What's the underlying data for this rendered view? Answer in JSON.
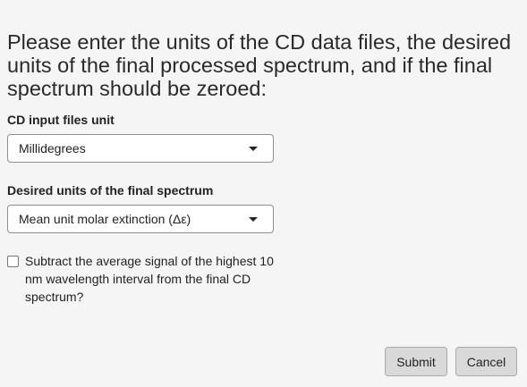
{
  "prompt": {
    "heading": "Please enter the units of the CD data files, the desired units of the final processed spectrum, and if the final spectrum should be zeroed:"
  },
  "input_unit": {
    "label": "CD input files unit",
    "selected": "Millidegrees"
  },
  "output_unit": {
    "label": "Desired units of the final spectrum",
    "selected": "Mean unit molar extinction (Δε)"
  },
  "zero_option": {
    "label": "Subtract the average signal of the highest 10 nm wavelength interval from the final CD spectrum?",
    "checked": false
  },
  "buttons": {
    "submit": "Submit",
    "cancel": "Cancel"
  }
}
